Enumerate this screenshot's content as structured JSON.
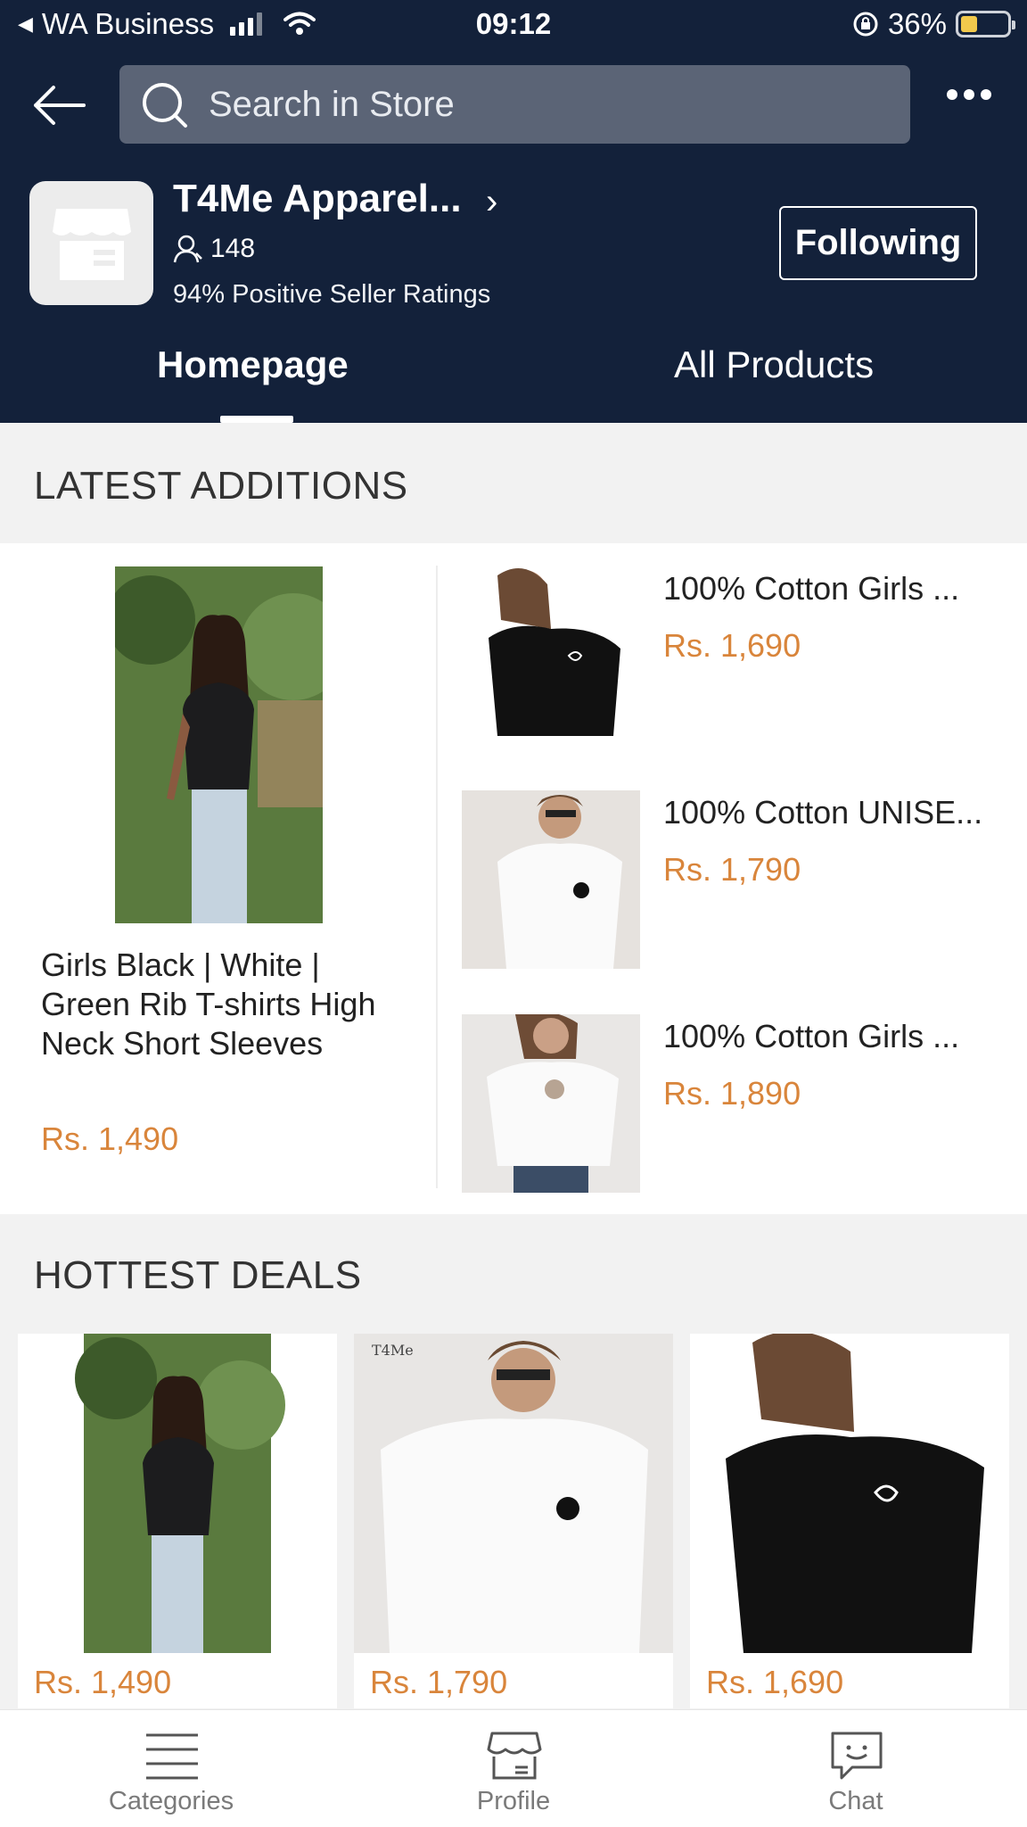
{
  "status_bar": {
    "carrier": "WA Business",
    "time": "09:12",
    "battery": "36%",
    "battery_level": 0.36
  },
  "search": {
    "placeholder": "Search in Store"
  },
  "store": {
    "name": "T4Me Apparel...",
    "followers": "148",
    "ratings": "94% Positive Seller Ratings",
    "follow_label": "Following"
  },
  "tabs": [
    {
      "label": "Homepage",
      "active": true
    },
    {
      "label": "All Products",
      "active": false
    }
  ],
  "latest": {
    "title": "LATEST ADDITIONS",
    "featured": {
      "name": "Girls Black | White | Green Rib T-shirts High Neck Short Sleeves",
      "price": "Rs. 1,490"
    },
    "items": [
      {
        "name": "100% Cotton Girls ...",
        "price": "Rs. 1,690"
      },
      {
        "name": "100% Cotton UNISE...",
        "price": "Rs. 1,790"
      },
      {
        "name": "100% Cotton Girls ...",
        "price": "Rs. 1,890"
      }
    ]
  },
  "hottest": {
    "title": "HOTTEST DEALS",
    "deals": [
      {
        "price": "Rs. 1,490"
      },
      {
        "price": "Rs. 1,790"
      },
      {
        "price": "Rs. 1,690"
      }
    ]
  },
  "bottom_nav": [
    {
      "label": "Categories",
      "icon": "categories-icon"
    },
    {
      "label": "Profile",
      "icon": "store-icon"
    },
    {
      "label": "Chat",
      "icon": "chat-icon"
    }
  ],
  "colors": {
    "header_bg": "#13213a",
    "price": "#d9853b",
    "search_bg": "#5b6476"
  }
}
